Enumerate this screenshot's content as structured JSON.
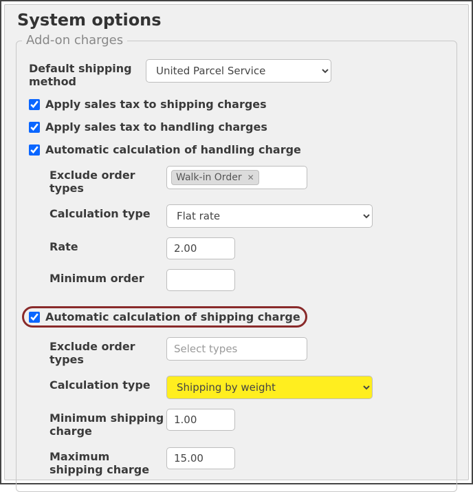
{
  "title": "System options",
  "fieldset_title": "Add-on charges",
  "default_shipping_label": "Default shipping method",
  "default_shipping_value": "United Parcel Service",
  "cb_tax_shipping": "Apply sales tax to shipping charges",
  "cb_tax_handling": "Apply sales tax to handling charges",
  "cb_auto_handling": "Automatic calculation of handling charge",
  "h_exclude_label": "Exclude order types",
  "h_exclude_tag": "Walk-in Order",
  "h_calc_type_label": "Calculation type",
  "h_calc_type_value": "Flat rate",
  "h_rate_label": "Rate",
  "h_rate_value": "2.00",
  "h_min_order_label": "Minimum order",
  "h_min_order_value": "",
  "cb_auto_shipping": "Automatic calculation of shipping charge",
  "s_exclude_label": "Exclude order types",
  "s_exclude_placeholder": "Select types",
  "s_calc_type_label": "Calculation type",
  "s_calc_type_value": "Shipping by weight",
  "s_min_label": "Minimum shipping charge",
  "s_min_value": "1.00",
  "s_max_label": "Maximum shipping charge",
  "s_max_value": "15.00"
}
